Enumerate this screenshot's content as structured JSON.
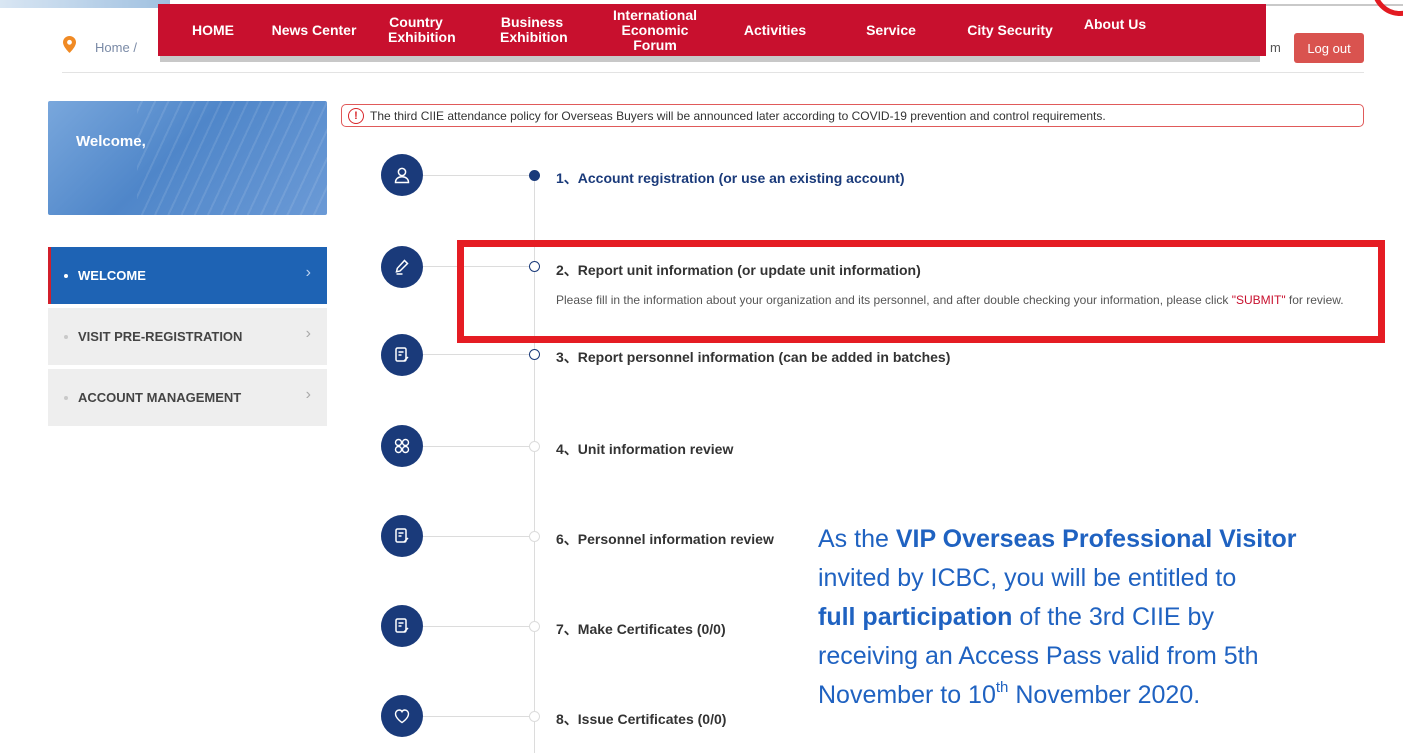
{
  "nav": {
    "items": [
      "HOME",
      "News Center",
      "Country Exhibition",
      "Business Exhibition",
      "International Economic Forum",
      "Activities",
      "Service",
      "City Security",
      "About Us"
    ]
  },
  "breadcrumb": {
    "home": "Home",
    "separator": "/",
    "tail": "m"
  },
  "header": {
    "logout_label": "Log out"
  },
  "sidebar": {
    "welcome": "Welcome,",
    "items": [
      {
        "label": "WELCOME",
        "active": true
      },
      {
        "label": "VISIT PRE-REGISTRATION",
        "active": false
      },
      {
        "label": "ACCOUNT MANAGEMENT",
        "active": false
      }
    ]
  },
  "notice": {
    "icon": "exclamation-icon",
    "text": "The third CIIE attendance policy for Overseas Buyers will be announced later according to COVID-19 prevention and control requirements."
  },
  "steps": [
    {
      "title": "1、Account registration (or use an existing account)",
      "icon": "user-icon"
    },
    {
      "title": "2、Report unit information (or update unit information)",
      "icon": "pen-icon",
      "desc_before": "Please fill in the information about your organization and its personnel, and after double checking your information, please click ",
      "desc_link": "\"SUBMIT\"",
      "desc_after": " for review."
    },
    {
      "title": "3、Report personnel information (can be added in batches)",
      "icon": "document-edit-icon"
    },
    {
      "title": "4、Unit information review",
      "icon": "apps-icon"
    },
    {
      "title": "6、Personnel information review",
      "icon": "document-edit-icon"
    },
    {
      "title": "7、Make Certificates (0/0)",
      "icon": "document-edit-icon"
    },
    {
      "title": "8、Issue Certificates (0/0)",
      "icon": "heart-icon"
    }
  ],
  "overlay": {
    "l1_a": "As the ",
    "l1_b": "VIP Overseas Professional Visitor",
    "l2": "invited by ICBC, you will be entitled to",
    "l3_a": "full participation",
    "l3_b": " of the 3rd CIIE by",
    "l4": "receiving an Access Pass valid from 5th",
    "l5_a": "November to 10",
    "l5_sup": "th",
    "l5_b": " November 2020."
  },
  "colors": {
    "nav_red": "#c8102e",
    "primary_navy": "#1a3a7a",
    "sidebar_active": "#1e63b4",
    "overlay_blue": "#1f62c1",
    "highlight_red": "#e51c23"
  }
}
